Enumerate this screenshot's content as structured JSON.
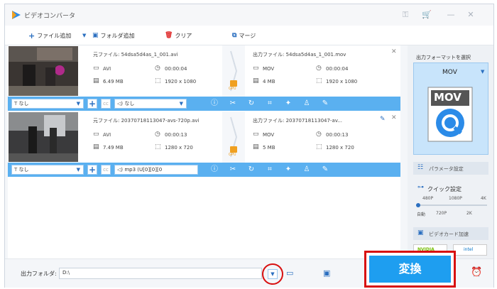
{
  "app": {
    "title": "ビデオコンバータ"
  },
  "toolbar": {
    "add_file": "ファイル追加",
    "add_folder": "フォルダ追加",
    "clear": "クリア",
    "merge": "マージ"
  },
  "files": [
    {
      "source_name": "元ファイル: 54dsa5d4as_1_001.avi",
      "source_format": "AVI",
      "source_duration": "00:00:04",
      "source_size": "6.49 MB",
      "source_resolution": "1920 x 1080",
      "output_name": "出力ファイル: 54dsa5d4as_1_001.mov",
      "output_format": "MOV",
      "output_duration": "00:00:04",
      "output_size": "4 MB",
      "output_resolution": "1920 x 1080",
      "subtitle": "なし",
      "audio": "なし"
    },
    {
      "source_name": "元ファイル: 20370718113047-avs-720p.avi",
      "source_format": "AVI",
      "source_duration": "00:00:13",
      "source_size": "7.49 MB",
      "source_resolution": "1280 x 720",
      "output_name": "出力ファイル: 20370718113047-av...",
      "output_format": "MOV",
      "output_duration": "00:00:13",
      "output_size": "5 MB",
      "output_resolution": "1280 x 720",
      "subtitle": "なし",
      "audio": "mp3 (U[0][0][0"
    }
  ],
  "gpu_label": "GPU",
  "sidebar": {
    "select_format": "出力フォーマットを選択",
    "format": "MOV",
    "format_icon_text": "MOV",
    "param_settings": "パラメータ設定",
    "quick_settings": "クイック設定",
    "quality_top": [
      "480P",
      "1080P",
      "4K"
    ],
    "quality_bottom": [
      "自動",
      "720P",
      "2K"
    ],
    "gpu_accel": "ビデオカード加速",
    "nvidia": "NVIDIA",
    "intel": "intel"
  },
  "bottom": {
    "output_folder_label": "出力フォルダ:",
    "output_folder_value": "D:\\",
    "convert": "変換"
  },
  "colors": {
    "accent": "#1e9ef0",
    "bar": "#5ab0f0",
    "highlight": "#d81010"
  }
}
